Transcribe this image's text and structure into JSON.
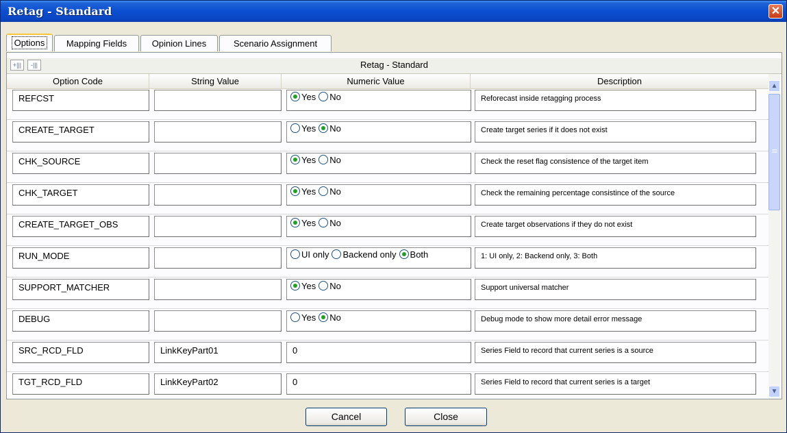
{
  "window": {
    "title": "Retag  - Standard",
    "close_glyph": "✕"
  },
  "tabs": [
    {
      "label": "Options"
    },
    {
      "label": "Mapping Fields"
    },
    {
      "label": "Opinion Lines"
    },
    {
      "label": "Scenario Assignment"
    }
  ],
  "grid": {
    "title": "Retag  - Standard",
    "columns": [
      "Option Code",
      "String Value",
      "Numeric Value",
      "Description"
    ],
    "rows": [
      {
        "code": "REFCST",
        "string": "",
        "description": "Reforecast inside retagging process",
        "options": [
          {
            "label": "Yes",
            "selected": true
          },
          {
            "label": "No",
            "selected": false
          }
        ]
      },
      {
        "code": "CREATE_TARGET",
        "string": "",
        "description": "Create target series if it does not exist",
        "options": [
          {
            "label": "Yes",
            "selected": false
          },
          {
            "label": "No",
            "selected": true
          }
        ]
      },
      {
        "code": "CHK_SOURCE",
        "string": "",
        "description": "Check the reset flag consistence of the target item",
        "options": [
          {
            "label": "Yes",
            "selected": true
          },
          {
            "label": "No",
            "selected": false
          }
        ]
      },
      {
        "code": "CHK_TARGET",
        "string": "",
        "description": "Check the remaining percentage consistince of the source",
        "options": [
          {
            "label": "Yes",
            "selected": true
          },
          {
            "label": "No",
            "selected": false
          }
        ]
      },
      {
        "code": "CREATE_TARGET_OBS",
        "string": "",
        "description": "Create target observations if they do not exist",
        "options": [
          {
            "label": "Yes",
            "selected": true
          },
          {
            "label": "No",
            "selected": false
          }
        ]
      },
      {
        "code": "RUN_MODE",
        "string": "",
        "description": "1: UI only, 2: Backend only, 3: Both",
        "options": [
          {
            "label": "UI only",
            "selected": false
          },
          {
            "label": "Backend only",
            "selected": false
          },
          {
            "label": "Both",
            "selected": true
          }
        ]
      },
      {
        "code": "SUPPORT_MATCHER",
        "string": "",
        "description": "Support universal matcher",
        "options": [
          {
            "label": "Yes",
            "selected": true
          },
          {
            "label": "No",
            "selected": false
          }
        ]
      },
      {
        "code": "DEBUG",
        "string": "",
        "description": "Debug mode to show more detail error message",
        "options": [
          {
            "label": "Yes",
            "selected": false
          },
          {
            "label": "No",
            "selected": true
          }
        ]
      },
      {
        "code": "SRC_RCD_FLD",
        "string": "LinkKeyPart01",
        "numeric": "0",
        "description": "Series Field to record that current series is a source"
      },
      {
        "code": "TGT_RCD_FLD",
        "string": "LinkKeyPart02",
        "numeric": "0",
        "description": "Series Field to record that current series is a target"
      }
    ]
  },
  "buttons": {
    "cancel": "Cancel",
    "close": "Close"
  }
}
